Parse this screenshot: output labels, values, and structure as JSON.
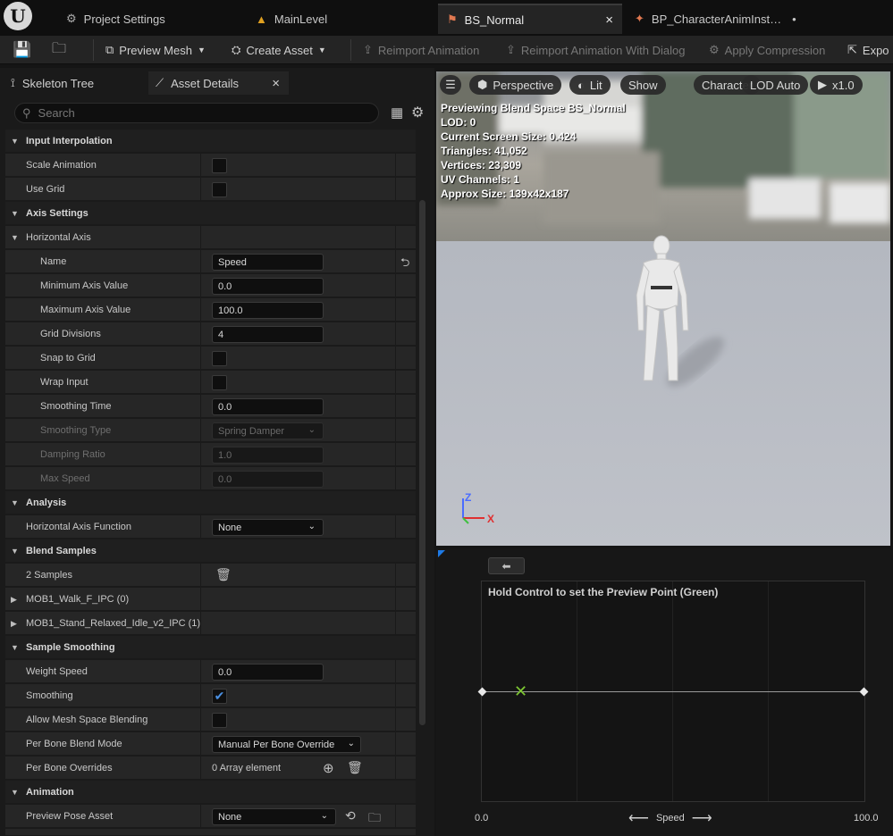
{
  "tabs": [
    {
      "label": "Project Settings",
      "icon": "settings-icon"
    },
    {
      "label": "MainLevel",
      "icon": "level-icon"
    },
    {
      "label": "BS_Normal",
      "icon": "blendspace-icon",
      "close": "×"
    },
    {
      "label": "BP_CharacterAnimInst…",
      "icon": "animbp-icon",
      "modified": "•"
    }
  ],
  "toolbar": {
    "preview_mesh": "Preview Mesh",
    "create_asset": "Create Asset",
    "reimport": "Reimport Animation",
    "reimport_dialog": "Reimport Animation With Dialog",
    "apply_compression": "Apply Compression",
    "export": "Expo"
  },
  "panel_tabs": {
    "skeleton_tree": "Skeleton Tree",
    "asset_details": "Asset Details",
    "close": "×"
  },
  "search": {
    "placeholder": "Search"
  },
  "details": {
    "input_interpolation": "Input Interpolation",
    "scale_animation": "Scale Animation",
    "use_grid": "Use Grid",
    "axis_settings": "Axis Settings",
    "horizontal_axis": "Horizontal Axis",
    "name_label": "Name",
    "name_value": "Speed",
    "min_label": "Minimum Axis Value",
    "min_value": "0.0",
    "max_label": "Maximum Axis Value",
    "max_value": "100.0",
    "grid_div_label": "Grid Divisions",
    "grid_div_value": "4",
    "snap_label": "Snap to Grid",
    "wrap_label": "Wrap Input",
    "smooth_time_label": "Smoothing Time",
    "smooth_time_value": "0.0",
    "smooth_type_label": "Smoothing Type",
    "smooth_type_value": "Spring Damper",
    "damping_label": "Damping Ratio",
    "damping_value": "1.0",
    "max_speed_label": "Max Speed",
    "max_speed_value": "0.0",
    "analysis": "Analysis",
    "h_axis_fn_label": "Horizontal Axis Function",
    "h_axis_fn_value": "None",
    "blend_samples": "Blend Samples",
    "samples_count": "2 Samples",
    "sample0": "MOB1_Walk_F_IPC (0)",
    "sample1": "MOB1_Stand_Relaxed_Idle_v2_IPC (1)",
    "sample_smoothing": "Sample Smoothing",
    "weight_speed_label": "Weight Speed",
    "weight_speed_value": "0.0",
    "smoothing_label": "Smoothing",
    "mesh_space_label": "Allow Mesh Space Blending",
    "per_bone_mode_label": "Per Bone Blend Mode",
    "per_bone_mode_value": "Manual Per Bone Override",
    "per_bone_overrides_label": "Per Bone Overrides",
    "per_bone_overrides_value": "0 Array element",
    "animation": "Animation",
    "preview_pose_label": "Preview Pose Asset",
    "preview_pose_value": "None"
  },
  "viewport": {
    "perspective": "Perspective",
    "lit": "Lit",
    "show": "Show",
    "character": "Character",
    "lod": "LOD Auto",
    "speed": "x1.0",
    "stats": [
      "Previewing Blend Space BS_Normal",
      "LOD: 0",
      "Current Screen Size: 0.424",
      "Triangles: 41,052",
      "Vertices: 23,309",
      "UV Channels: 1",
      "Approx Size: 139x42x187"
    ],
    "axis_z": "Z",
    "axis_x": "X"
  },
  "blend_graph": {
    "hint": "Hold Control to set the Preview Point (Green)",
    "axis_min": "0.0",
    "axis_max": "100.0",
    "axis_name": "Speed",
    "preview_point": 0.1
  }
}
